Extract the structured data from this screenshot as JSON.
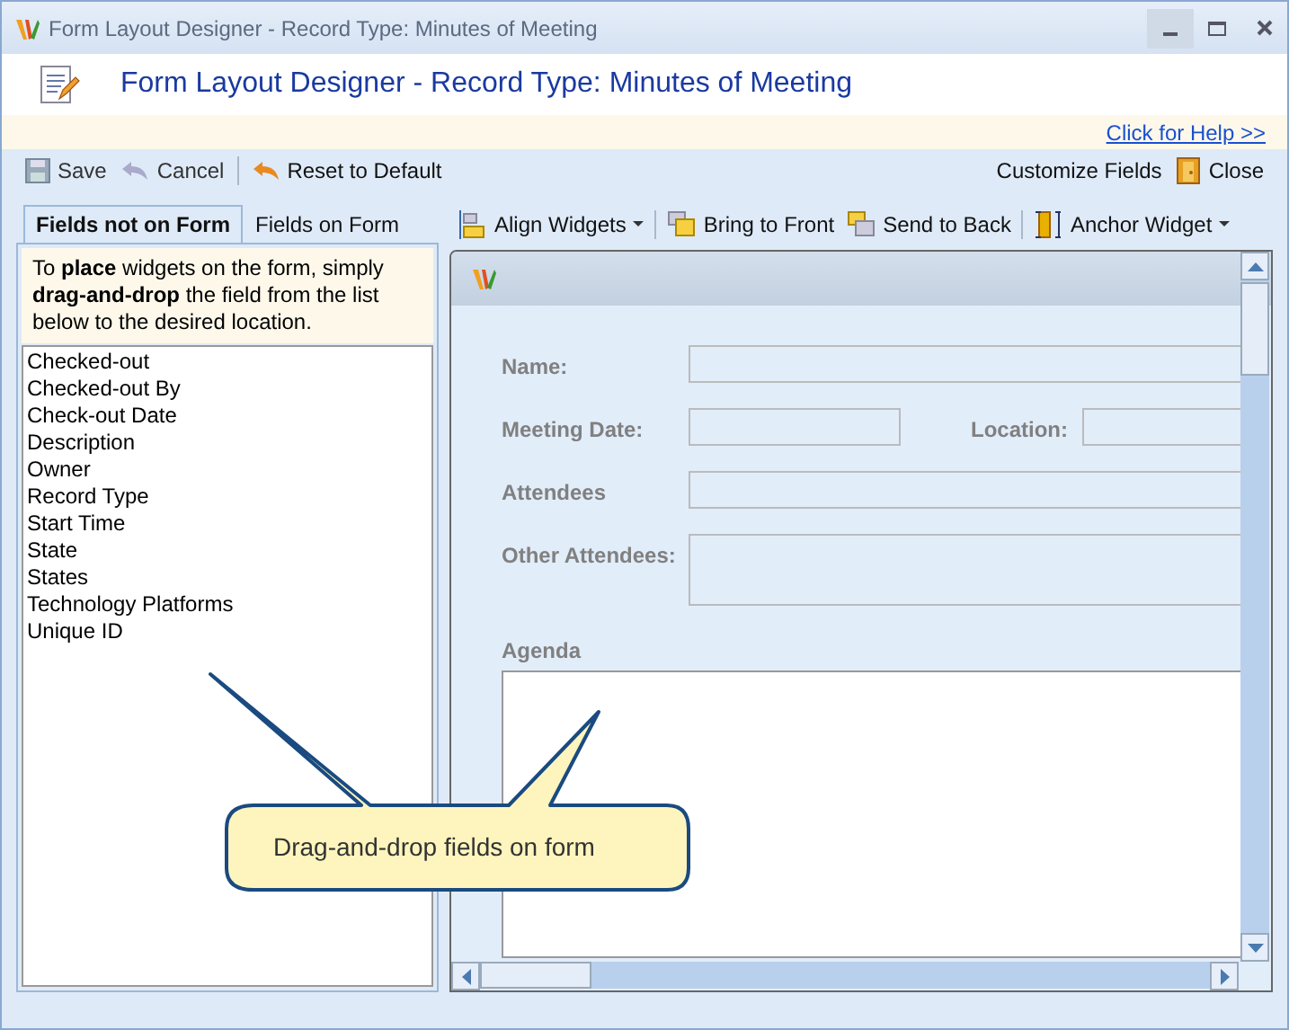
{
  "window": {
    "title": "Form Layout Designer - Record Type: Minutes of Meeting"
  },
  "header": {
    "title": "Form Layout Designer - Record Type: Minutes of Meeting"
  },
  "help_link": "Click for Help >>",
  "toolbar": {
    "left": [
      {
        "label": "Save",
        "kind": "save",
        "disabled": true
      },
      {
        "label": "Cancel",
        "kind": "cancel",
        "disabled": true
      },
      {
        "label": "Reset to Default",
        "kind": "reset",
        "disabled": false
      }
    ],
    "right": [
      {
        "label": "Customize Fields",
        "kind": "text"
      },
      {
        "label": "Close",
        "kind": "close"
      }
    ]
  },
  "tabs": [
    {
      "label": "Fields not on Form",
      "selected": true
    },
    {
      "label": "Fields on Form",
      "selected": false
    }
  ],
  "hint": "To **place** widgets on the form, simply **drag-and-drop** the field from the list below to the desired location.",
  "fields": [
    "Checked-out",
    "Checked-out By",
    "Check-out Date",
    "Description",
    "Owner",
    "Record Type",
    "Start Time",
    "State",
    "States",
    "Technology Platforms",
    "Unique ID"
  ],
  "designer_toolbar": [
    {
      "label": "Align Widgets",
      "kind": "align",
      "dropdown": true
    },
    {
      "label": "Bring to Front",
      "kind": "front",
      "dropdown": false
    },
    {
      "label": "Send to Back",
      "kind": "back",
      "dropdown": false
    },
    {
      "label": "Anchor Widget",
      "kind": "anchor",
      "dropdown": true
    }
  ],
  "form": [
    {
      "label": "Name:",
      "kind": "wide"
    },
    {
      "label": "Meeting Date:",
      "kind": "date"
    },
    {
      "label": "Location:",
      "kind": "side"
    },
    {
      "label": "Attendees",
      "kind": "wide"
    },
    {
      "label": "Other Attendees:",
      "kind": "tall"
    },
    {
      "label": "Agenda",
      "kind": "area"
    }
  ],
  "callout": "Drag-and-drop fields on form"
}
